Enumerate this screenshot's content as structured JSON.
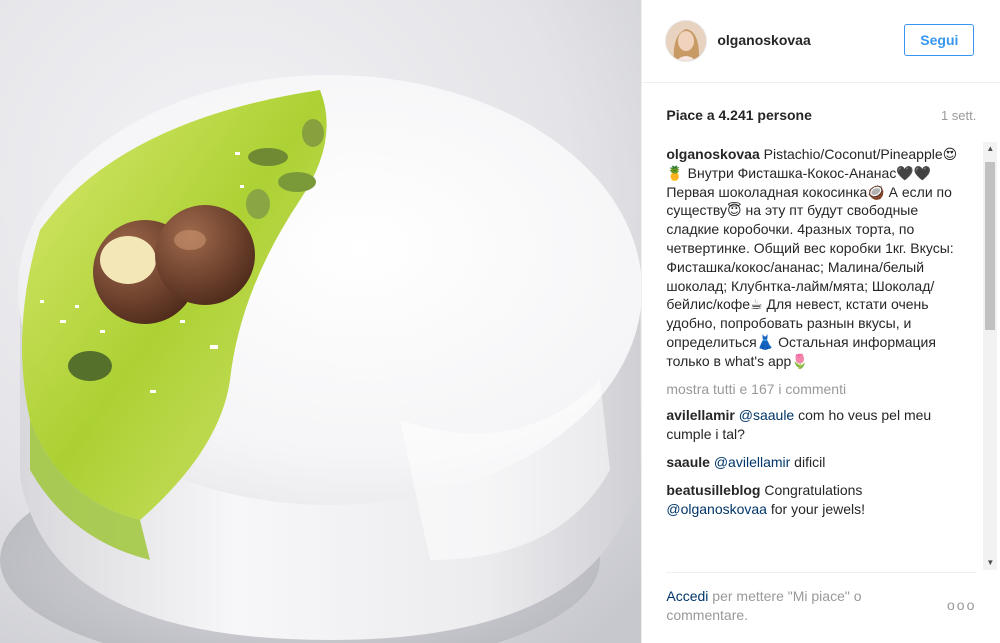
{
  "header": {
    "username": "olganoskovaa",
    "follow_label": "Segui"
  },
  "stats": {
    "likes": "Piace a 4.241 persone",
    "time": "1 sett."
  },
  "caption": {
    "user": "olganoskovaa",
    "text": "Pistachio/Coconut/Pineapple😍🍍 Внутри Фисташка-Кокос-Ананас🖤🖤 Первая шоколадная кокосинка🥥 А если по существу😇 на эту пт будут свободные сладкие коробочки. 4разных торта, по четвертинке. Общий вес коробки 1кг. Вкусы: Фисташка/кокос/ананас; Малина/белый шоколад; Клубнтка-лайм/мята; Шоколад/бейлис/кофе☕ Для невест, кстати очень удобно, попробовать разнын вкусы, и определиться👗 Остальная информация только в what's app🌷"
  },
  "view_all": "mostra tutti e 167 i commenti",
  "comments": [
    {
      "user": "avilellamir",
      "mention": "@saaule",
      "text": " com ho veus pel meu cumple i tal?"
    },
    {
      "user": "saaule",
      "mention": "@avilellamir",
      "text": " dificil"
    },
    {
      "user": "beatusilleblog",
      "mention": "",
      "text": " Congratulations ",
      "mention2": "@olganoskovaa",
      "text2": " for your jewels!"
    }
  ],
  "footer": {
    "login_link": "Accedi",
    "login_rest": " per mettere \"Mi piace\" o commentare.",
    "more": "ooo"
  },
  "colors": {
    "accent": "#3897f0",
    "link": "#003569",
    "muted": "#999999",
    "text": "#262626"
  }
}
